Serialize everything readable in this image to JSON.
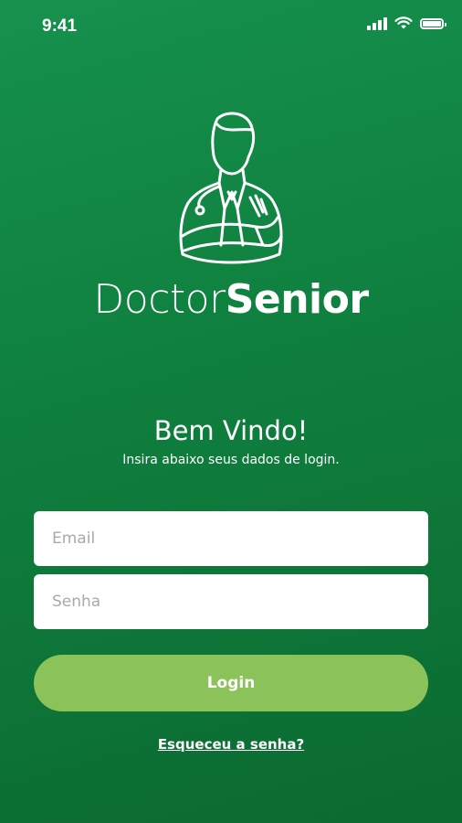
{
  "status_bar": {
    "time": "9:41"
  },
  "brand": {
    "name_light": "Doctor",
    "name_bold": "Senior"
  },
  "welcome": {
    "title": "Bem Vindo!",
    "subtitle": "Insira abaixo seus dados de login."
  },
  "form": {
    "email_placeholder": "Email",
    "password_placeholder": "Senha",
    "login_label": "Login",
    "forgot_label": "Esqueceu a senha?"
  },
  "colors": {
    "background": "#0f7f3e",
    "button": "#8bc25a"
  }
}
